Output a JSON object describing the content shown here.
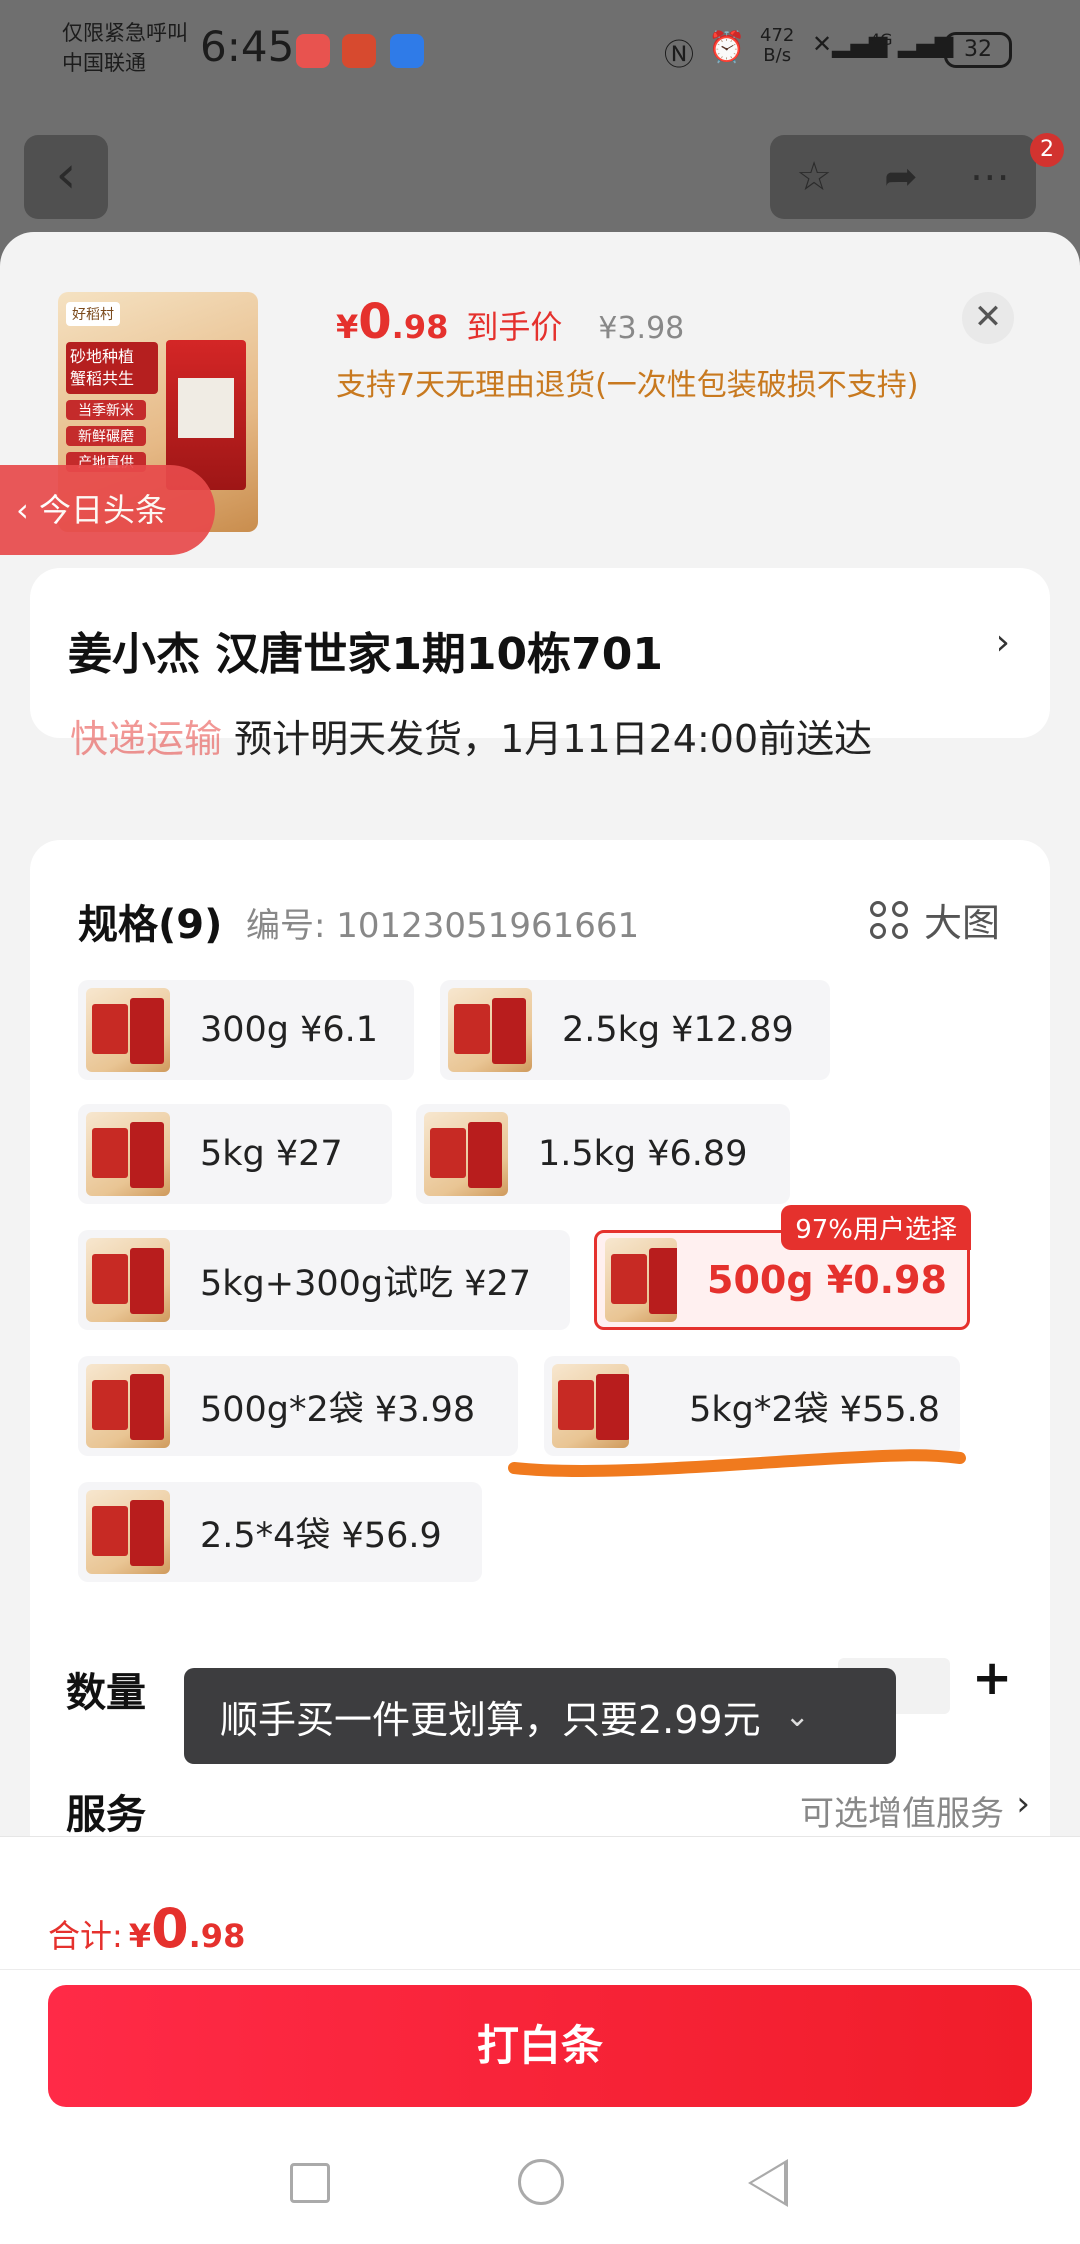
{
  "status_bar": {
    "carrier_line1": "仅限紧急呼叫",
    "carrier_line2": "中国联通",
    "time": "6:45",
    "net_speed_value": "472",
    "net_speed_unit": "B/s",
    "net_type": "4G",
    "battery": "32"
  },
  "nav": {
    "back_icon": "chevron-left-icon",
    "actions": [
      "star-icon",
      "share-icon",
      "more-icon"
    ],
    "badge_count": "2"
  },
  "product": {
    "brand": "好稻村",
    "image_tagline": "砂地种植 蟹稻共生",
    "image_tags": [
      "当季新米",
      "新鲜碾磨",
      "产地直供"
    ],
    "currency": "¥",
    "price_int": "0",
    "price_dec": ".98",
    "price_note": "到手价",
    "original_price": "¥3.98",
    "refund_note": "支持7天无理由退货(一次性包装破损不支持)",
    "close_icon": "close-icon"
  },
  "address": {
    "recipient_line": "姜小杰  汉唐世家1期10栋701",
    "shipping_prefix": "快递运输",
    "shipping_text": " 预计明天发货，1月11日24:00前送达"
  },
  "floating_tab": {
    "label": "今日头条"
  },
  "spec": {
    "title": "规格(9)",
    "code": "编号: 10123051961661",
    "big_view": "大图",
    "options": [
      {
        "label": "300g  ¥6.1"
      },
      {
        "label": "2.5kg  ¥12.89"
      },
      {
        "label": "5kg  ¥27"
      },
      {
        "label": "1.5kg  ¥6.89"
      },
      {
        "label": "5kg+300g试吃  ¥27"
      },
      {
        "label": "500g  ¥0.98",
        "popular": "97%用户选择"
      },
      {
        "label": "500g*2袋  ¥3.98"
      },
      {
        "label": "5kg*2袋  ¥55.8"
      },
      {
        "label": "2.5*4袋  ¥56.9"
      }
    ],
    "highlight_color": "#f07a1e"
  },
  "quantity": {
    "label": "数量"
  },
  "toast": {
    "text": "顺手买一件更划算，只要2.99元"
  },
  "service": {
    "label": "服务",
    "value": "可选增值服务"
  },
  "footer": {
    "total_label": "合计:",
    "currency": "¥",
    "total_int": "0",
    "total_dec": ".98",
    "pay_button": "打白条"
  },
  "colors": {
    "accent": "#e5312d",
    "pay_button": "#ff2a47",
    "refund_text": "#c8791f"
  }
}
